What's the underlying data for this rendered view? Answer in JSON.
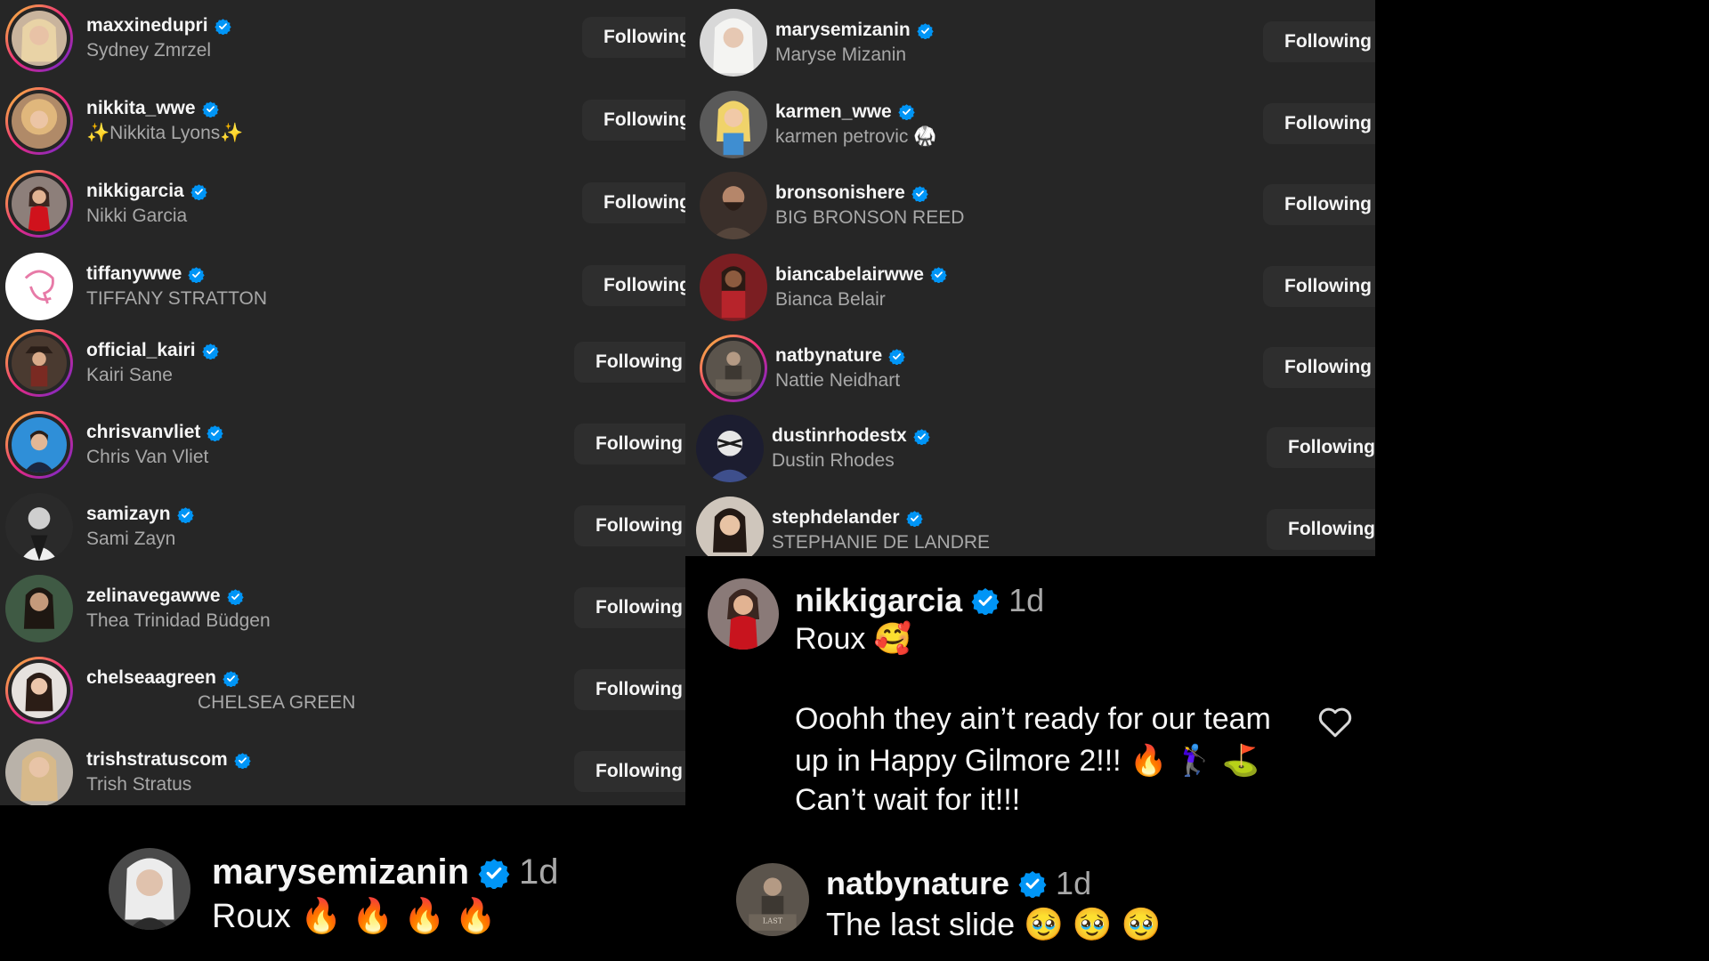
{
  "left_list_top": [
    {
      "username": "maxxinedupri",
      "fullname": "Sydney Zmrzel",
      "button": "Following",
      "avatar": "photo-blonde-woman",
      "ring": true
    },
    {
      "username": "nikkita_wwe",
      "fullname": "✨Nikkita Lyons✨",
      "button": "Following",
      "avatar": "photo-curly-blonde-woman",
      "ring": true
    },
    {
      "username": "nikkigarcia",
      "fullname": "Nikki Garcia",
      "button": "Following",
      "avatar": "photo-woman-red-dress",
      "ring": true
    },
    {
      "username": "tiffanywwe",
      "fullname": "TIFFANY STRATTON",
      "button": "Following",
      "avatar": "pink-logo",
      "ring": false
    }
  ],
  "left_list_bottom": [
    {
      "username": "official_kairi",
      "fullname": "Kairi Sane",
      "button": "Following",
      "avatar": "photo-pirate-costume",
      "ring": true
    },
    {
      "username": "chrisvanvliet",
      "fullname": "Chris Van Vliet",
      "button": "Following",
      "avatar": "photo-man-blue-background",
      "ring": true
    },
    {
      "username": "samizayn",
      "fullname": "Sami Zayn",
      "button": "Following",
      "avatar": "photo-bw-man",
      "ring": false
    },
    {
      "username": "zelinavegawwe",
      "fullname": "Thea Trinidad Büdgen",
      "button": "Following",
      "avatar": "photo-woman-green",
      "ring": false
    },
    {
      "username": "chelseaagreen",
      "fullname": "CHELSEA GREEN",
      "button": "Following",
      "avatar": "photo-dark-hair-woman",
      "ring": true
    },
    {
      "username": "trishstratuscom",
      "fullname": "Trish Stratus",
      "button": "Following",
      "avatar": "photo-blonde-woman-2",
      "ring": false
    }
  ],
  "right_list_top": [
    {
      "username": "marysemizanin",
      "fullname": "Maryse Mizanin",
      "button": "Following",
      "avatar": "photo-platinum-woman",
      "ring": false
    },
    {
      "username": "karmen_wwe",
      "fullname": "karmen petrovic 🥋",
      "button": "Following",
      "avatar": "cartoon-fighter",
      "ring": false
    },
    {
      "username": "bronsonishere",
      "fullname": "BIG BRONSON REED",
      "button": "Following",
      "avatar": "photo-bearded-man",
      "ring": false
    },
    {
      "username": "biancabelairwwe",
      "fullname": "Bianca Belair",
      "button": "Following",
      "avatar": "photo-woman-red",
      "ring": false
    },
    {
      "username": "natbynature",
      "fullname": "Nattie Neidhart",
      "button": "Following",
      "avatar": "book-cover",
      "ring": true
    }
  ],
  "right_list_bottom": [
    {
      "username": "dustinrhodestx",
      "fullname": "Dustin Rhodes",
      "button": "Following",
      "avatar": "photo-painted-face",
      "ring": false
    },
    {
      "username": "stephdelander",
      "fullname": "STEPHANIE DE LANDRE",
      "button": "Following",
      "avatar": "photo-smiling-woman",
      "ring": false
    }
  ],
  "comments": {
    "nikki": {
      "username": "nikkigarcia",
      "time": "1d",
      "line1": "Roux 🥰",
      "line2": "Ooohh they ain’t ready for our team",
      "line3": "up in Happy Gilmore 2!!! 🔥 🏌️‍♀️ ⛳",
      "line4": "Can’t wait for it!!!"
    },
    "maryse": {
      "username": "marysemizanin",
      "time": "1d",
      "text": "Roux 🔥 🔥 🔥 🔥"
    },
    "nattie": {
      "username": "natbynature",
      "time": "1d",
      "text": "The last slide 🥹 🥹 🥹"
    }
  },
  "colors": {
    "panel": "#262626",
    "button": "#2e2e2e",
    "verified": "#0095f6",
    "muted": "#a8a8a8",
    "background": "#000000"
  },
  "icons": {
    "verified": "verified-badge-icon",
    "like": "heart-outline-icon"
  }
}
